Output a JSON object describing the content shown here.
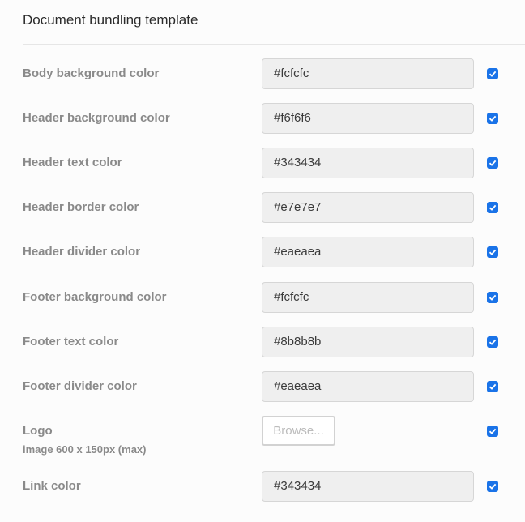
{
  "title": "Document bundling template",
  "accent_color": "#1a73e8",
  "rows": [
    {
      "label": "Body background color",
      "value": "#fcfcfc",
      "checked": true
    },
    {
      "label": "Header background color",
      "value": "#f6f6f6",
      "checked": true
    },
    {
      "label": "Header text color",
      "value": "#343434",
      "checked": true
    },
    {
      "label": "Header border color",
      "value": "#e7e7e7",
      "checked": true
    },
    {
      "label": "Header divider color",
      "value": "#eaeaea",
      "checked": true
    },
    {
      "label": "Footer background color",
      "value": "#fcfcfc",
      "checked": true
    },
    {
      "label": "Footer text color",
      "value": "#8b8b8b",
      "checked": true
    },
    {
      "label": "Footer divider color",
      "value": "#eaeaea",
      "checked": true
    }
  ],
  "logo": {
    "label": "Logo",
    "hint": "image 600 x 150px (max)",
    "button_label": "Browse...",
    "checked": true
  },
  "link": {
    "label": "Link color",
    "value": "#343434",
    "checked": true
  }
}
